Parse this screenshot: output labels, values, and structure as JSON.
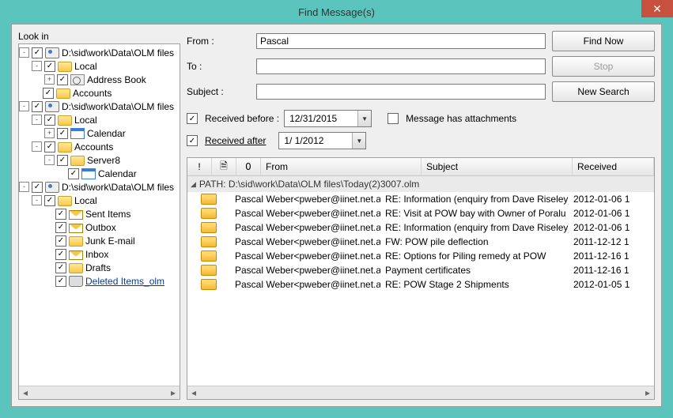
{
  "window": {
    "title": "Find Message(s)"
  },
  "look_in_label": "Look in",
  "tree": [
    {
      "level": 0,
      "pm": "-",
      "check": true,
      "icon": "db",
      "label": "D:\\sid\\work\\Data\\OLM files"
    },
    {
      "level": 1,
      "pm": "-",
      "check": true,
      "icon": "folder",
      "label": "Local"
    },
    {
      "level": 2,
      "pm": "+",
      "check": true,
      "icon": "book",
      "label": "Address Book"
    },
    {
      "level": 1,
      "pm": "",
      "check": true,
      "icon": "folder",
      "label": "Accounts"
    },
    {
      "level": 0,
      "pm": "-",
      "check": true,
      "icon": "db",
      "label": "D:\\sid\\work\\Data\\OLM files"
    },
    {
      "level": 1,
      "pm": "-",
      "check": true,
      "icon": "folder",
      "label": "Local"
    },
    {
      "level": 2,
      "pm": "+",
      "check": true,
      "icon": "cal",
      "label": "Calendar"
    },
    {
      "level": 1,
      "pm": "-",
      "check": true,
      "icon": "folder",
      "label": "Accounts"
    },
    {
      "level": 2,
      "pm": "-",
      "check": true,
      "icon": "folder",
      "label": "Server8"
    },
    {
      "level": 3,
      "pm": "",
      "check": true,
      "icon": "cal",
      "label": "Calendar"
    },
    {
      "level": 0,
      "pm": "-",
      "check": true,
      "icon": "db",
      "label": "D:\\sid\\work\\Data\\OLM files"
    },
    {
      "level": 1,
      "pm": "-",
      "check": true,
      "icon": "folder",
      "label": "Local"
    },
    {
      "level": 2,
      "pm": "",
      "check": true,
      "icon": "mail",
      "label": "Sent Items"
    },
    {
      "level": 2,
      "pm": "",
      "check": true,
      "icon": "mail",
      "label": "Outbox"
    },
    {
      "level": 2,
      "pm": "",
      "check": true,
      "icon": "folder",
      "label": "Junk E-mail"
    },
    {
      "level": 2,
      "pm": "",
      "check": true,
      "icon": "mail",
      "label": "Inbox"
    },
    {
      "level": 2,
      "pm": "",
      "check": true,
      "icon": "folder",
      "label": "Drafts"
    },
    {
      "level": 2,
      "pm": "",
      "check": true,
      "icon": "trash",
      "label": "Deleted Items_olm",
      "underline": true
    }
  ],
  "search": {
    "from_label": "From :",
    "to_label": "To :",
    "subject_label": "Subject :",
    "from_value": "Pascal",
    "to_value": "",
    "subject_value": ""
  },
  "buttons": {
    "find_now": "Find Now",
    "stop": "Stop",
    "new_search": "New Search"
  },
  "filters": {
    "received_before_label": "Received before :",
    "received_before_value": "12/31/2015",
    "received_before_checked": true,
    "received_after_label": "Received after",
    "received_after_value": " 1/ 1/2012",
    "received_after_checked": true,
    "attachments_label": "Message has attachments",
    "attachments_checked": false
  },
  "columns": {
    "priority": "!",
    "attachment_icon": "🗎",
    "clip_icon": "📎",
    "from": "From",
    "subject": "Subject",
    "received": "Received"
  },
  "group_header": "PATH: D:\\sid\\work\\Data\\OLM files\\Today(2)3007.olm",
  "messages": [
    {
      "from": "Pascal Weber<pweber@iinet.net.au>",
      "subject": "RE: Information (enquiry from Dave Riseley)",
      "received": "2012-01-06 1"
    },
    {
      "from": "Pascal Weber<pweber@iinet.net.au>",
      "subject": "RE: Visit at POW bay with Owner of Poralu Marine",
      "received": "2012-01-06 1"
    },
    {
      "from": "Pascal Weber<pweber@iinet.net.au>",
      "subject": "RE: Information (enquiry from Dave Riseley)",
      "received": "2012-01-06 1"
    },
    {
      "from": "Pascal Weber<pweber@iinet.net.au>",
      "subject": "FW: POW pile deflection",
      "received": "2011-12-12 1"
    },
    {
      "from": "Pascal Weber<pweber@iinet.net.au>",
      "subject": "RE: Options for Piling remedy at POW",
      "received": "2011-12-16 1"
    },
    {
      "from": "Pascal Weber<pweber@iinet.net.au>",
      "subject": "Payment certificates",
      "received": "2011-12-16 1"
    },
    {
      "from": "Pascal Weber<pweber@iinet.net.au>",
      "subject": "RE: POW Stage 2 Shipments",
      "received": "2012-01-05 1"
    }
  ]
}
